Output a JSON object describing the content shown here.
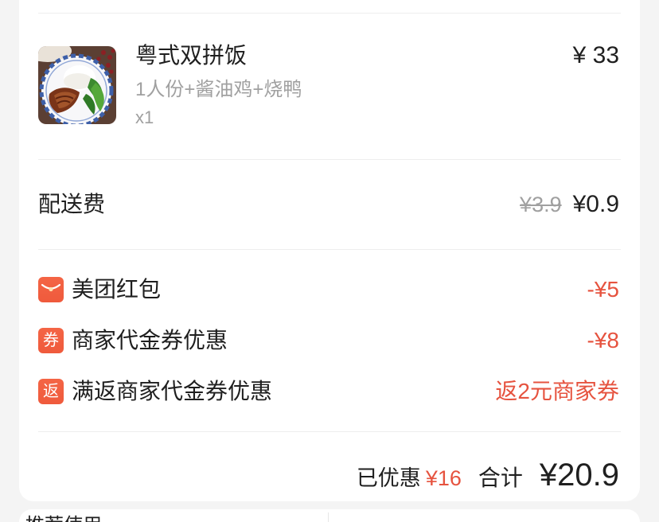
{
  "item": {
    "thumbnail_icon": "dish-photo-icon",
    "name": "粤式双拼饭",
    "spec": "1人份+酱油鸡+烧鸭",
    "quantity": "x1",
    "price": "¥ 33"
  },
  "delivery": {
    "label": "配送费",
    "original_price": "¥3.9",
    "price": "¥0.9"
  },
  "discounts": [
    {
      "icon": "red-packet-icon",
      "label": "美团红包",
      "amount": "-¥5"
    },
    {
      "icon": "coupon-icon",
      "icon_text": "券",
      "label": "商家代金券优惠",
      "amount": "-¥8"
    },
    {
      "icon": "rebate-icon",
      "icon_text": "返",
      "label": "满返商家代金券优惠",
      "amount": "返2元商家券"
    }
  ],
  "summary": {
    "discount_label": "已优惠",
    "discount_amount": "¥16",
    "total_label": "合计",
    "total_amount": "¥20.9"
  },
  "next_section": {
    "title": "推荐使用"
  },
  "colors": {
    "accent_red": "#e6533f",
    "icon_red": "#ef5a3c",
    "text_primary": "#1f1f1f",
    "text_secondary": "#a0a0a0",
    "background": "#f4f4f4",
    "card": "#ffffff"
  }
}
